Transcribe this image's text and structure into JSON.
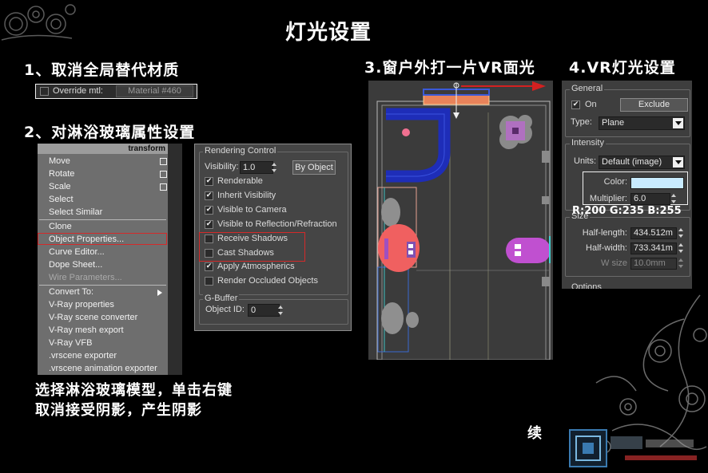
{
  "title": "灯光设置",
  "step1": {
    "heading": "1、取消全局替代材质",
    "override_label": "Override mtl:",
    "override_checked": false,
    "material_button": "Material #460"
  },
  "step2": {
    "heading": "2、对淋浴玻璃属性设置",
    "instruction_line1": "选择淋浴玻璃模型，单击右键",
    "instruction_line2": "取消接受阴影，产生阴影"
  },
  "quad_menu": {
    "header": "transform",
    "items": [
      {
        "label": "Move"
      },
      {
        "label": "Rotate"
      },
      {
        "label": "Scale"
      },
      {
        "label": "Select"
      },
      {
        "label": "Select Similar"
      },
      {
        "label": "Clone"
      },
      {
        "label": "Object Properties..."
      },
      {
        "label": "Curve Editor..."
      },
      {
        "label": "Dope Sheet..."
      },
      {
        "label": "Wire Parameters...",
        "disabled": true
      },
      {
        "label": "Convert To:"
      },
      {
        "label": "V-Ray properties"
      },
      {
        "label": "V-Ray scene converter"
      },
      {
        "label": "V-Ray mesh export"
      },
      {
        "label": "V-Ray VFB"
      },
      {
        "label": ".vrscene exporter"
      },
      {
        "label": ".vrscene animation exporter"
      }
    ]
  },
  "rendering_control": {
    "group_title": "Rendering Control",
    "visibility_label": "Visibility:",
    "visibility_value": "1.0",
    "by_object_button": "By Object",
    "options": [
      {
        "label": "Renderable",
        "checked": true
      },
      {
        "label": "Inherit Visibility",
        "checked": true
      },
      {
        "label": "Visible to Camera",
        "checked": true
      },
      {
        "label": "Visible to Reflection/Refraction",
        "checked": true
      },
      {
        "label": "Receive Shadows",
        "checked": false
      },
      {
        "label": "Cast Shadows",
        "checked": false
      },
      {
        "label": "Apply Atmospherics",
        "checked": true
      },
      {
        "label": "Render Occluded Objects",
        "checked": false
      }
    ],
    "gbuffer_title": "G-Buffer",
    "object_id_label": "Object ID:",
    "object_id_value": "0"
  },
  "step3": {
    "heading": "3.窗户外打一片VR面光"
  },
  "step4": {
    "heading": "4.VR灯光设置"
  },
  "vray_light": {
    "general_title": "General",
    "on_label": "On",
    "on_checked": true,
    "exclude_button": "Exclude",
    "type_label": "Type:",
    "type_value": "Plane",
    "intensity_title": "Intensity",
    "units_label": "Units:",
    "units_value": "Default (image)",
    "color_label": "Color:",
    "color_value": "#c8ebff",
    "multiplier_label": "Multiplier:",
    "multiplier_value": "6.0",
    "size_title": "Size",
    "half_length_label": "Half-length:",
    "half_length_value": "434.512m",
    "half_width_label": "Half-width:",
    "half_width_value": "733.341m",
    "w_size_label": "W size",
    "w_size_value": "10.0mm",
    "options_title": "Options"
  },
  "color_readout": "R:200 G:235 B:255",
  "continue_label": "续",
  "colors": {
    "background": "#000000",
    "highlight_box": "#d42a2a",
    "light_arrow": "#d42020",
    "bathtub": "#1e2db8",
    "light_panel": "#e8835a"
  }
}
